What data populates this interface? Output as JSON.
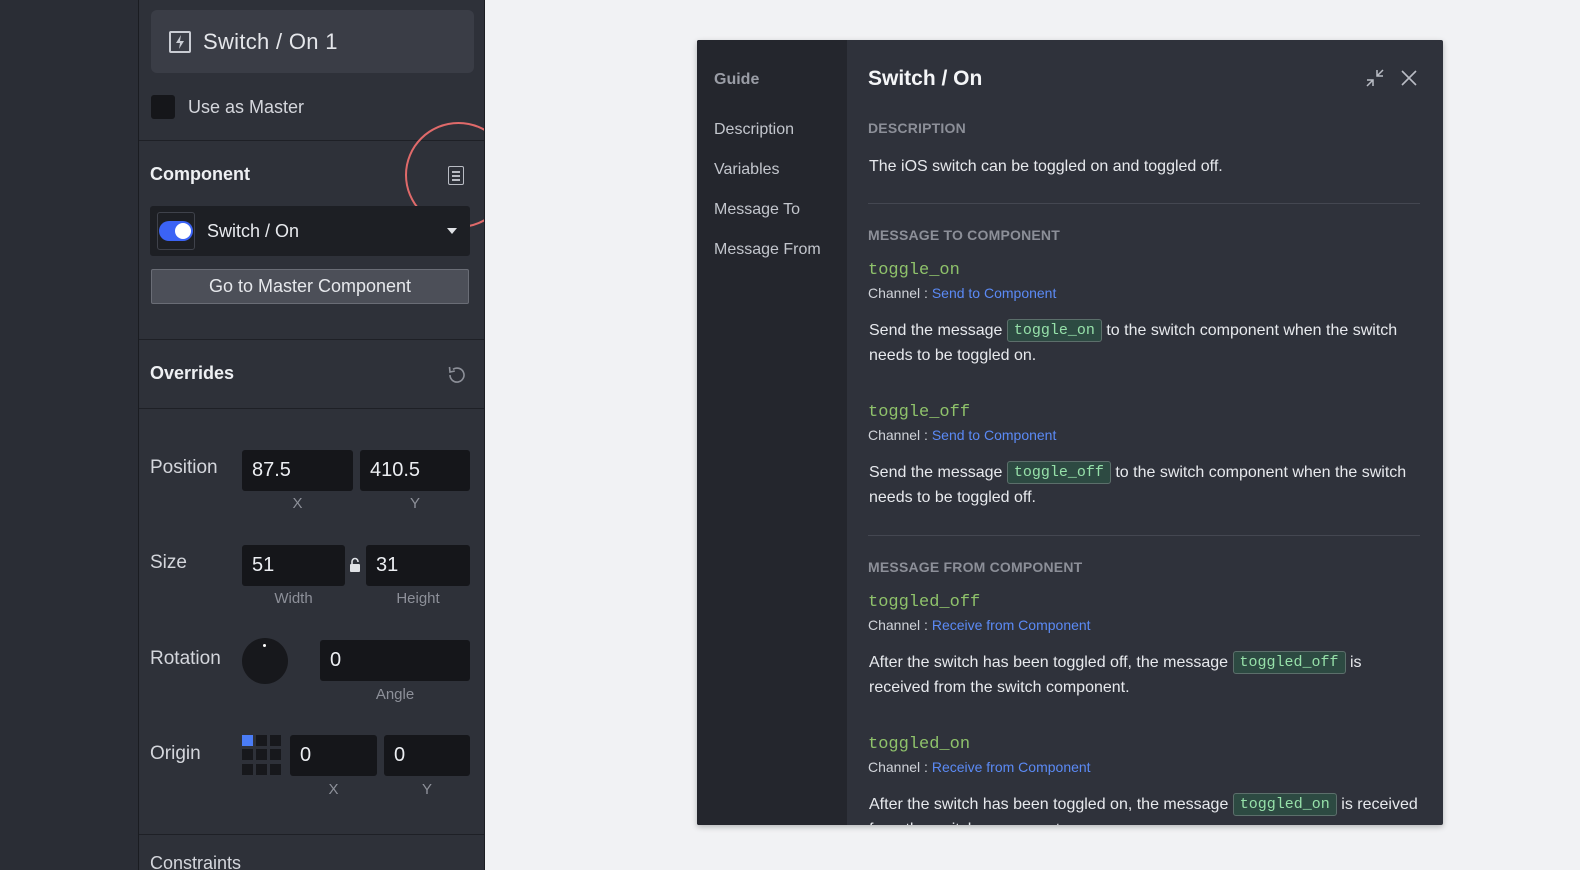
{
  "inspector": {
    "instance_name": "Switch / On 1",
    "use_as_master_label": "Use as Master",
    "component_section_title": "Component",
    "component_selected": "Switch / On",
    "goto_master_label": "Go to Master Component",
    "overrides_title": "Overrides",
    "position": {
      "label": "Position",
      "x": "87.5",
      "y": "410.5",
      "x_label": "X",
      "y_label": "Y"
    },
    "size": {
      "label": "Size",
      "width": "51",
      "height": "31",
      "width_label": "Width",
      "height_label": "Height"
    },
    "rotation": {
      "label": "Rotation",
      "angle": "0",
      "angle_label": "Angle"
    },
    "origin": {
      "label": "Origin",
      "x": "0",
      "y": "0",
      "x_label": "X",
      "y_label": "Y"
    },
    "next_section_title": "Constraints"
  },
  "guide": {
    "nav_title": "Guide",
    "nav_items": [
      "Description",
      "Variables",
      "Message To",
      "Message From"
    ],
    "title": "Switch / On",
    "description_caption": "DESCRIPTION",
    "description_text": "The iOS switch can be toggled on and toggled off.",
    "message_to_caption": "MESSAGE TO COMPONENT",
    "message_from_caption": "MESSAGE FROM COMPONENT",
    "channel_label": "Channel :",
    "messages_to": [
      {
        "name": "toggle_on",
        "channel": "Send to Component",
        "text_before": "Send the message",
        "chip": "toggle_on",
        "text_after": "to the switch component when the switch needs to be toggled on."
      },
      {
        "name": "toggle_off",
        "channel": "Send to Component",
        "text_before": "Send the message",
        "chip": "toggle_off",
        "text_after": "to the switch component when the switch needs to be toggled off."
      }
    ],
    "messages_from": [
      {
        "name": "toggled_off",
        "channel": "Receive from Component",
        "text_before": "After the switch has been toggled off, the message",
        "chip": "toggled_off",
        "text_after": "is received from the switch component."
      },
      {
        "name": "toggled_on",
        "channel": "Receive from Component",
        "text_before": "After the switch has been toggled on, the message",
        "chip": "toggled_on",
        "text_after": "is received from the switch component."
      }
    ]
  },
  "colors": {
    "accent": "#3b63f5",
    "link": "#5b8af5",
    "code_green": "#8fc26b",
    "highlight_circle": "#e06a6a"
  },
  "icons": [
    "component-instance-icon",
    "document-icon",
    "reset-icon",
    "lock-icon",
    "collapse-icon",
    "close-icon"
  ]
}
